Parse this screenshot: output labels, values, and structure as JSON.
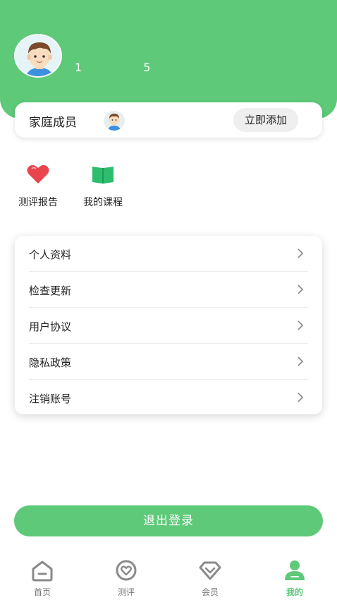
{
  "header": {
    "phone_prefix": "1",
    "phone_suffix": "5"
  },
  "family": {
    "label": "家庭成员",
    "add_button": "立即添加"
  },
  "shortcuts": [
    {
      "label": "测评报告",
      "icon": "heart-icon"
    },
    {
      "label": "我的课程",
      "icon": "book-icon"
    }
  ],
  "menu": [
    {
      "label": "个人资料"
    },
    {
      "label": "检查更新"
    },
    {
      "label": "用户协议"
    },
    {
      "label": "隐私政策"
    },
    {
      "label": "注销账号"
    }
  ],
  "logout_label": "退出登录",
  "tabs": [
    {
      "label": "首页",
      "icon": "home-icon",
      "active": false
    },
    {
      "label": "测评",
      "icon": "assessment-icon",
      "active": false
    },
    {
      "label": "会员",
      "icon": "diamond-icon",
      "active": false
    },
    {
      "label": "我的",
      "icon": "person-icon",
      "active": true
    }
  ],
  "colors": {
    "accent": "#5ec978",
    "heart": "#e8454f",
    "book": "#2dbd6e"
  }
}
